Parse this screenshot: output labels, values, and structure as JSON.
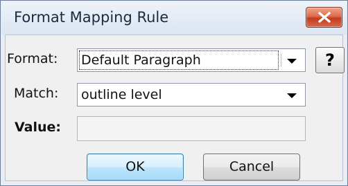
{
  "window": {
    "title": "Format Mapping Rule",
    "close_icon": "close-icon"
  },
  "form": {
    "format_label": "Format:",
    "format_value": "Default Paragraph",
    "match_label": "Match:",
    "match_value": "outline level",
    "value_label": "Value:",
    "value_text": ""
  },
  "help": {
    "label": "?"
  },
  "buttons": {
    "ok": "OK",
    "cancel": "Cancel"
  },
  "colors": {
    "close_button": "#c23c1d",
    "ok_button": "#bee6fd"
  }
}
